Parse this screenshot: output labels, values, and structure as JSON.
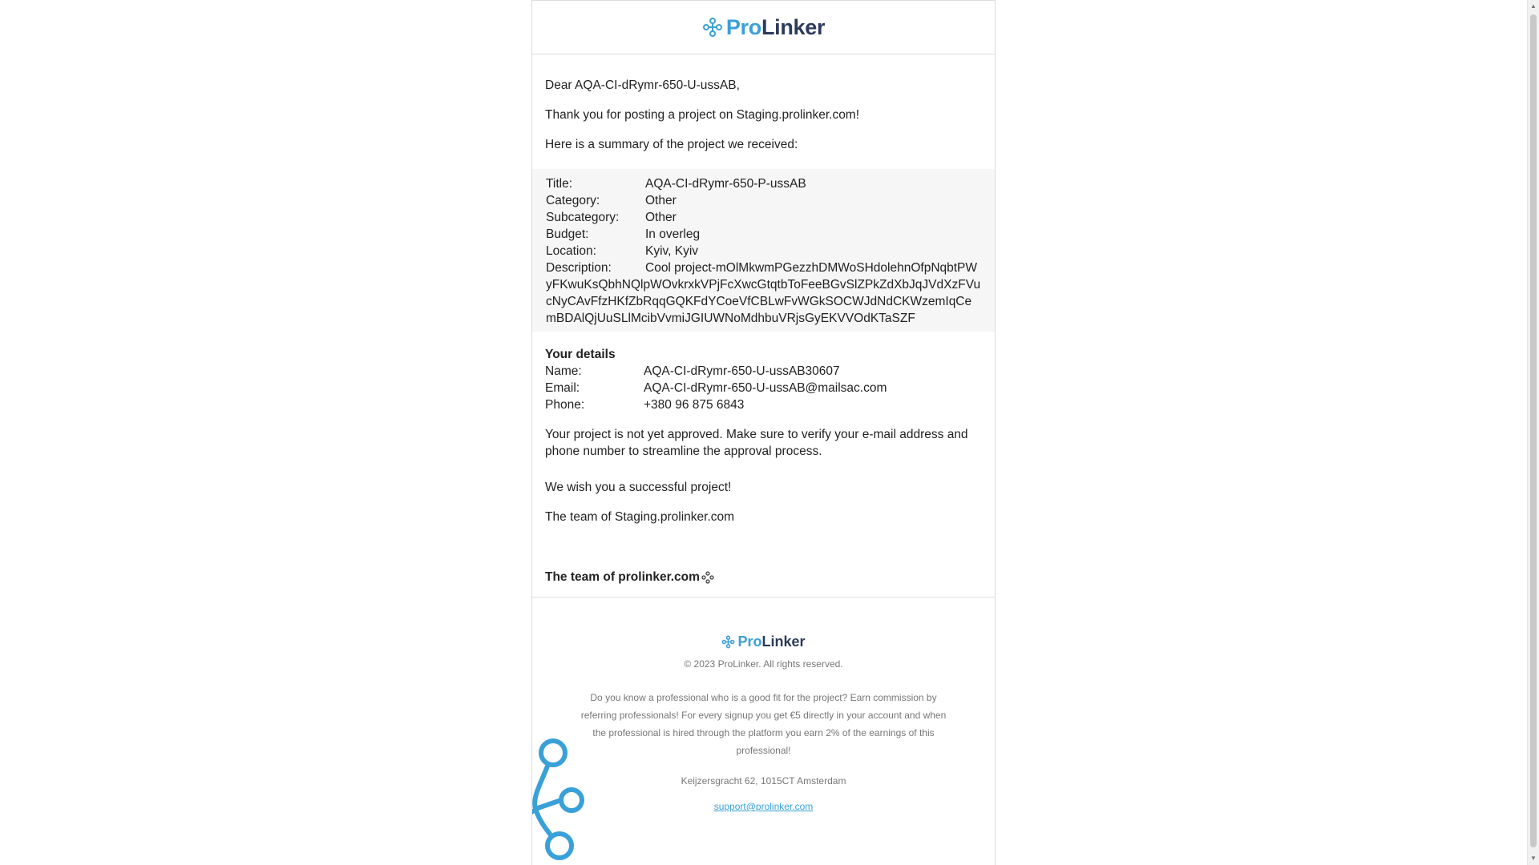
{
  "brand": {
    "pro": "Pro",
    "linker": "Linker",
    "accent": "#3aa0d8",
    "dark": "#2d3a5c"
  },
  "greeting": "Dear AQA-CI-dRymr-650-U-ussAB,",
  "thanks": "Thank you for posting a project on Staging.prolinker.com!",
  "summary_intro": "Here is a summary of the project we received:",
  "project": {
    "title_label": "Title:",
    "title": "AQA-CI-dRymr-650-P-ussAB",
    "category_label": "Category:",
    "category": "Other",
    "subcategory_label": "Subcategory:",
    "subcategory": "Other",
    "budget_label": "Budget:",
    "budget": "In overleg",
    "location_label": "Location:",
    "location": "Kyiv, Kyiv",
    "description_label": "Description:",
    "description": "Cool project-mOlMkwmPGezzhDMWoSHdolehnOfpNqbtPWyFKwuKsQbhNQlpWOvkrxkVPjFcXwcGtqtbToFeeBGvSlZPkZdXbJqJVdXzFVucNyCAvFfzHKfZbRqqGQKFdYCoeVfCBLwFvWGkSOCWJdNdCKWzemIqCemBDAlQjUuSLlMcibVvmiJGIUWNoMdhbuVRjsGyEKVVOdKTaSZF"
  },
  "details": {
    "heading": "Your details",
    "name_label": "Name:",
    "name": "AQA-CI-dRymr-650-U-ussAB30607",
    "email_label": "Email:",
    "email": "AQA-CI-dRymr-650-U-ussAB@mailsac.com",
    "phone_label": "Phone:",
    "phone": "+380 96 875 6843"
  },
  "not_approved": "Your project is not yet approved. Make sure to verify your e-mail address and phone number to streamline the approval process.",
  "wish": "We wish you a successful project!",
  "team": "The team of Staging.prolinker.com",
  "team_bold": "The team of prolinker.com",
  "footer": {
    "copyright": "© 2023 ProLinker. All rights reserved.",
    "promo": "Do you know a professional who is a good fit for the project? Earn commission by referring professionals! For every signup you get €5 directly in your account and when the professional is hired through the platform you earn 2% of the earnings of this professional!",
    "address": "Keijzersgracht 62, 1015CT Amsterdam",
    "support_email": "support@prolinker.com"
  }
}
